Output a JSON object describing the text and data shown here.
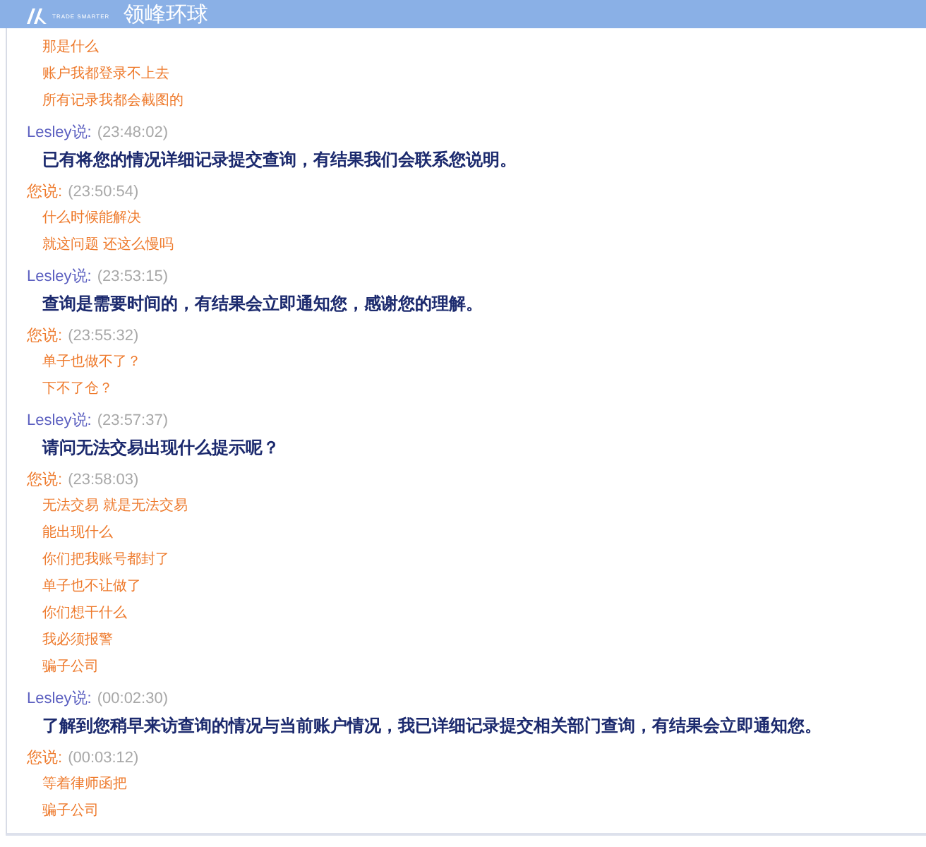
{
  "header": {
    "logo_tagline": "TRADE SMARTER",
    "title": "领峰环球"
  },
  "messages": [
    {
      "kind": "customer",
      "lines": [
        "那是什么",
        "账户我都登录不上去",
        "所有记录我都会截图的"
      ]
    },
    {
      "kind": "agent",
      "speaker": "Lesley说:",
      "time": "(23:48:02)",
      "lines": [
        "已有将您的情况详细记录提交查询，有结果我们会联系您说明。"
      ]
    },
    {
      "kind": "customer",
      "speaker": "您说:",
      "time": "(23:50:54)",
      "lines": [
        "什么时候能解决",
        "就这问题 还这么慢吗"
      ]
    },
    {
      "kind": "agent",
      "speaker": "Lesley说:",
      "time": "(23:53:15)",
      "lines": [
        "查询是需要时间的，有结果会立即通知您，感谢您的理解。"
      ]
    },
    {
      "kind": "customer",
      "speaker": "您说:",
      "time": "(23:55:32)",
      "lines": [
        "单子也做不了？",
        "下不了仓？"
      ]
    },
    {
      "kind": "agent",
      "speaker": "Lesley说:",
      "time": "(23:57:37)",
      "lines": [
        "请问无法交易出现什么提示呢？"
      ]
    },
    {
      "kind": "customer",
      "speaker": "您说:",
      "time": "(23:58:03)",
      "lines": [
        "无法交易 就是无法交易",
        "能出现什么",
        "你们把我账号都封了",
        "单子也不让做了",
        "你们想干什么",
        "我必须报警",
        "骗子公司"
      ]
    },
    {
      "kind": "agent",
      "speaker": "Lesley说:",
      "time": "(00:02:30)",
      "lines": [
        "了解到您稍早来访查询的情况与当前账户情况，我已详细记录提交相关部门查询，有结果会立即通知您。"
      ]
    },
    {
      "kind": "customer",
      "speaker": "您说:",
      "time": "(00:03:12)",
      "lines": [
        "等着律师函把",
        "骗子公司"
      ]
    }
  ]
}
